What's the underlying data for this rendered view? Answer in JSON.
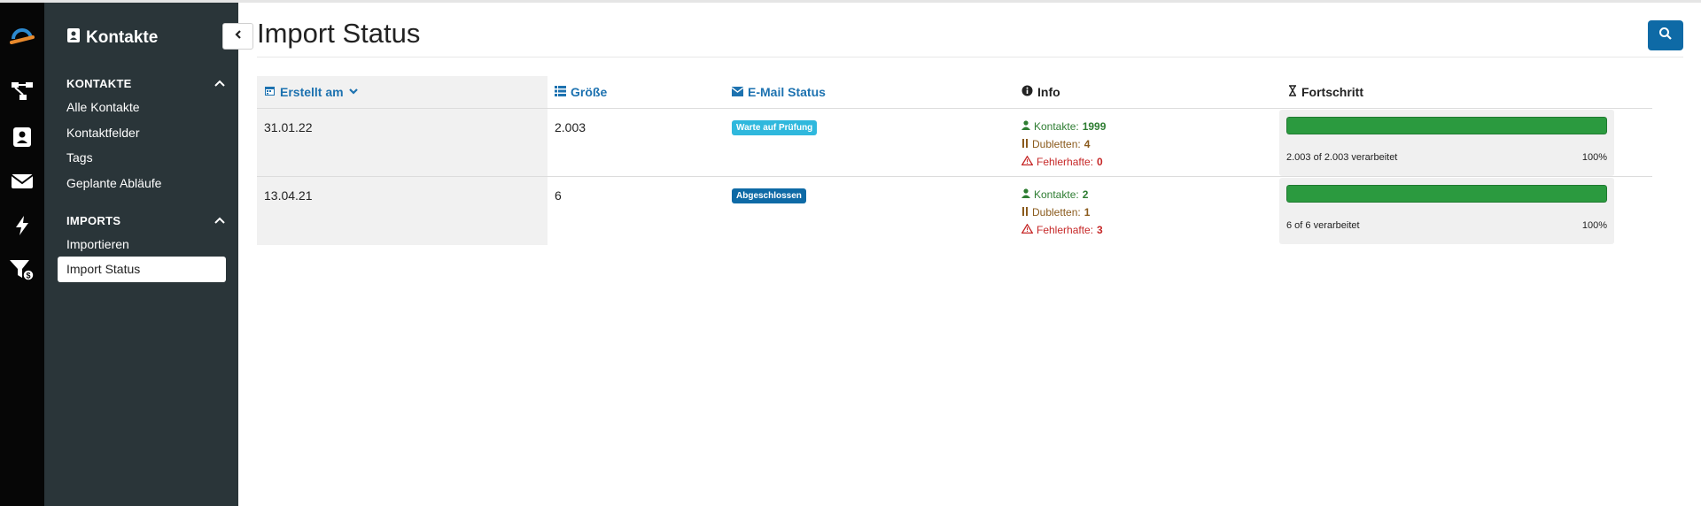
{
  "sidebar": {
    "title": "Kontakte",
    "sections": [
      {
        "label": "KONTAKTE",
        "items": [
          "Alle Kontakte",
          "Kontaktfelder",
          "Tags",
          "Geplante Abläufe"
        ]
      },
      {
        "label": "IMPORTS",
        "items": [
          "Importieren",
          "Import Status"
        ]
      }
    ],
    "active_item": "Import Status"
  },
  "page": {
    "title": "Import Status"
  },
  "table": {
    "headers": {
      "created": "Erstellt am",
      "size": "Größe",
      "email_status": "E-Mail Status",
      "info": "Info",
      "progress": "Fortschritt"
    },
    "rows": [
      {
        "created": "31.01.22",
        "size": "2.003",
        "status": "Warte auf Prüfung",
        "status_color": "#2fb8dd",
        "contacts_label": "Kontakte:",
        "contacts": "1999",
        "duplicates_label": "Dubletten:",
        "duplicates": "4",
        "errors_label": "Fehlerhafte:",
        "errors": "0",
        "progress_text": "2.003 of 2.003 verarbeitet",
        "progress_pct": "100%",
        "progress_fraction": 1.0
      },
      {
        "created": "13.04.21",
        "size": "6",
        "status": "Abgeschlossen",
        "status_color": "#0e6aa6",
        "contacts_label": "Kontakte:",
        "contacts": "2",
        "duplicates_label": "Dubletten:",
        "duplicates": "1",
        "errors_label": "Fehlerhafte:",
        "errors": "3",
        "progress_text": "6 of 6 verarbeitet",
        "progress_pct": "100%",
        "progress_fraction": 1.0
      }
    ]
  },
  "colors": {
    "accent": "#0e6aa6",
    "sidebar_bg": "#2a3539",
    "rail_bg": "#060606",
    "progress": "#2b9a3f"
  },
  "icons": {
    "rail": [
      "logo-icon",
      "flow-icon",
      "contacts-icon",
      "envelope-icon",
      "bolt-icon",
      "funnel-dollar-icon"
    ],
    "search": "search-icon"
  }
}
